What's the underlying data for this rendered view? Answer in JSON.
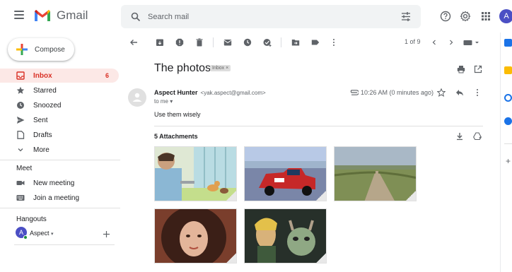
{
  "app": {
    "name": "Gmail"
  },
  "search": {
    "placeholder": "Search mail"
  },
  "account": {
    "initial": "A"
  },
  "sidebar": {
    "compose_label": "Compose",
    "items": [
      {
        "label": "Inbox",
        "count": "6",
        "icon": "inbox-icon",
        "active": true
      },
      {
        "label": "Starred",
        "icon": "star-icon"
      },
      {
        "label": "Snoozed",
        "icon": "clock-icon"
      },
      {
        "label": "Sent",
        "icon": "send-icon"
      },
      {
        "label": "Drafts",
        "icon": "draft-icon"
      },
      {
        "label": "More",
        "icon": "chevron-down-icon"
      }
    ],
    "meet": {
      "title": "Meet",
      "items": [
        {
          "label": "New meeting",
          "icon": "video-icon"
        },
        {
          "label": "Join a meeting",
          "icon": "keyboard-icon"
        }
      ]
    },
    "hangouts": {
      "title": "Hangouts",
      "user": "Aspect",
      "user_initial": "A"
    }
  },
  "toolbar": {
    "pager": "1 of 9"
  },
  "message": {
    "subject": "The photos",
    "label": "Inbox",
    "sender_name": "Aspect Hunter",
    "sender_email": "<yak.aspect@gmail.com>",
    "to": "to me",
    "time": "10:26 AM (0 minutes ago)",
    "body": "Use them wisely",
    "attachments_title": "5 Attachments"
  },
  "colors": {
    "accent_red": "#d93025",
    "active_bg": "#fce8e6",
    "avatar": "#4b4fc4"
  }
}
